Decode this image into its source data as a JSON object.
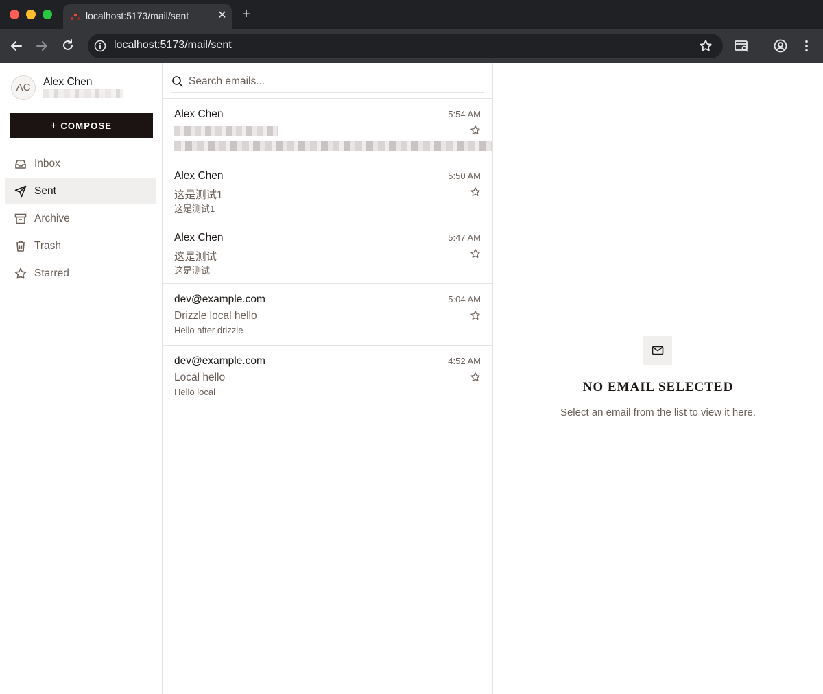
{
  "browser": {
    "tab_title": "localhost:5173/mail/sent",
    "new_tab_label": "+",
    "url": "localhost:5173/mail/sent"
  },
  "sidebar": {
    "avatar_initials": "AC",
    "user_name": "Alex Chen",
    "compose_label": "COMPOSE",
    "items": [
      {
        "label": "Inbox",
        "icon": "inbox-icon",
        "active": false
      },
      {
        "label": "Sent",
        "icon": "send-icon",
        "active": true
      },
      {
        "label": "Archive",
        "icon": "archive-icon",
        "active": false
      },
      {
        "label": "Trash",
        "icon": "trash-icon",
        "active": false
      },
      {
        "label": "Starred",
        "icon": "star-icon",
        "active": false
      }
    ]
  },
  "search": {
    "placeholder": "Search emails..."
  },
  "emails": [
    {
      "sender": "Alex Chen",
      "time": "5:54 AM",
      "subject": "",
      "preview": "",
      "redacted": true
    },
    {
      "sender": "Alex Chen",
      "time": "5:50 AM",
      "subject": "这是测试1",
      "preview": "这是测试1"
    },
    {
      "sender": "Alex Chen",
      "time": "5:47 AM",
      "subject": "这是测试",
      "preview": "这是测试"
    },
    {
      "sender": "dev@example.com",
      "time": "5:04 AM",
      "subject": "Drizzle local hello",
      "preview": "Hello after drizzle"
    },
    {
      "sender": "dev@example.com",
      "time": "4:52 AM",
      "subject": "Local hello",
      "preview": "Hello local"
    }
  ],
  "reader": {
    "empty_title": "NO EMAIL SELECTED",
    "empty_text": "Select an email from the list to view it here."
  }
}
